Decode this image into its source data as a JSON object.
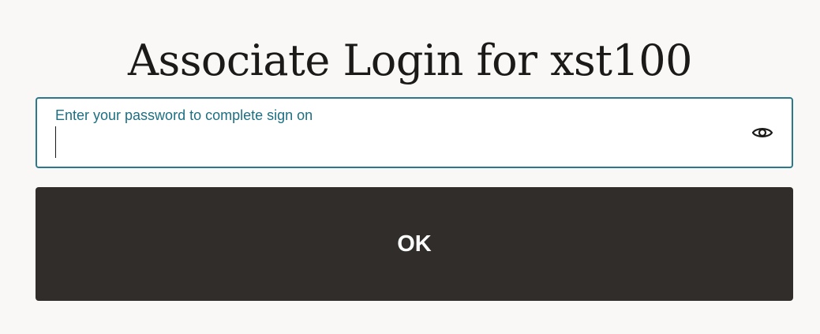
{
  "page": {
    "title": "Associate Login for xst100"
  },
  "password_field": {
    "label": "Enter your password to complete sign on",
    "value": "",
    "toggle_icon": "eye-icon"
  },
  "actions": {
    "ok_label": "OK"
  },
  "colors": {
    "background": "#f9f8f6",
    "field_border": "#2b7a8c",
    "label_text": "#1d6f82",
    "button_bg": "#312d2a",
    "button_text": "#ffffff"
  }
}
